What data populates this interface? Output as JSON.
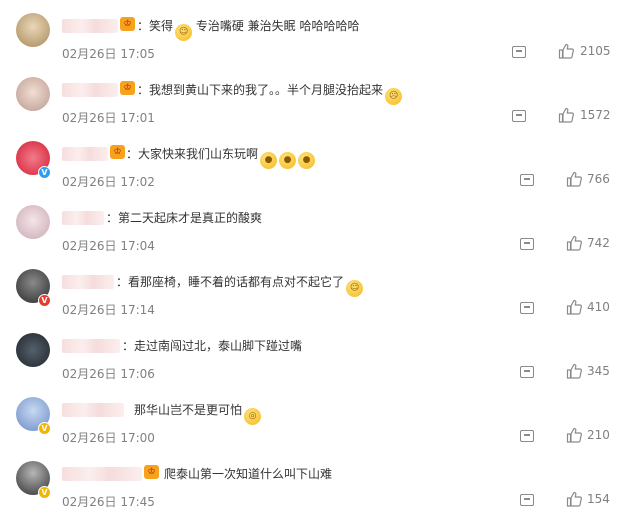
{
  "comments": [
    {
      "text": "笑得",
      "text2": " 专治嘴硬 兼治失眠 哈哈哈哈哈",
      "time": "02月26日 17:05",
      "likes": "2105",
      "has_vip": true,
      "has_colon": true
    },
    {
      "text": "我想到黄山下来的我了。。半个月腿没抬起来",
      "text2": "",
      "time": "02月26日 17:01",
      "likes": "1572",
      "has_vip": true,
      "has_colon": true
    },
    {
      "text": "大家快来我们山东玩啊",
      "text2": "",
      "time": "02月26日 17:02",
      "likes": "766",
      "has_vip": true,
      "has_colon": false
    },
    {
      "text": "第二天起床才是真正的酸爽",
      "text2": "",
      "time": "02月26日 17:04",
      "likes": "742",
      "has_vip": false,
      "has_colon": true
    },
    {
      "text": "看那座椅，睡不着的话都有点对不起它了",
      "text2": "",
      "time": "02月26日 17:14",
      "likes": "410",
      "has_vip": false,
      "has_colon": true
    },
    {
      "text": "走过南闯过北，泰山脚下踫过嘴",
      "text2": "",
      "time": "02月26日 17:06",
      "likes": "345",
      "has_vip": false,
      "has_colon": true
    },
    {
      "text": "那华山岂不是更可怕",
      "text2": "",
      "time": "02月26日 17:00",
      "likes": "210",
      "has_vip": false,
      "has_colon": false
    },
    {
      "text": "爬泰山第一次知道什么叫下山难",
      "text2": "",
      "time": "02月26日 17:45",
      "likes": "154",
      "has_vip": true,
      "has_colon": false
    }
  ],
  "icons": {
    "comment": "comment-icon",
    "like": "thumbs-up-icon",
    "vip": "crown-vip-icon"
  },
  "colors": {
    "text": "#333333",
    "meta": "#808080",
    "redacted_name": "#f7dede",
    "vip": "#f6a21c"
  }
}
